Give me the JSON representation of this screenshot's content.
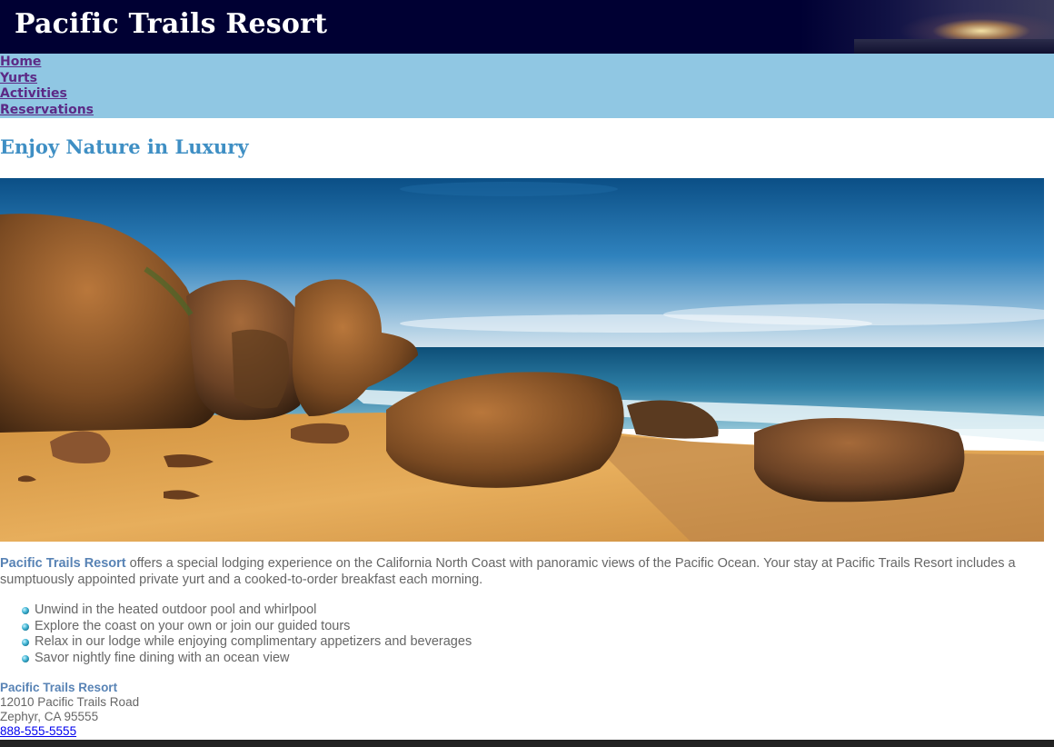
{
  "header": {
    "title": "Pacific Trails Resort"
  },
  "nav": {
    "items": [
      "Home",
      "Yurts",
      "Activities",
      "Reservations"
    ]
  },
  "main": {
    "heading": "Enjoy Nature in Luxury",
    "intro": {
      "brand": "Pacific Trails Resort",
      "text": " offers a special lodging experience on the California North Coast with panoramic views of the Pacific Ocean. Your stay at Pacific Trails Resort includes a sumptuously appointed private yurt and a cooked-to-order breakfast each morning."
    },
    "features": [
      "Unwind in the heated outdoor pool and whirlpool",
      "Explore the coast on your own or join our guided tours",
      "Relax in our lodge while enjoying complimentary appetizers and beverages",
      "Savor nightly fine dining with an ocean view"
    ],
    "address": {
      "name": "Pacific Trails Resort",
      "street": "12010 Pacific Trails Road",
      "city": "Zephyr, CA 95555",
      "phone": "888-555-5555"
    }
  },
  "colors": {
    "header_bg": "#000033",
    "nav_bg": "#90c7e3",
    "heading": "#3f8fc4",
    "brand": "#5883b5",
    "body_text": "#666666"
  },
  "icons": {
    "list_bullet": "sphere-bullet-icon"
  }
}
